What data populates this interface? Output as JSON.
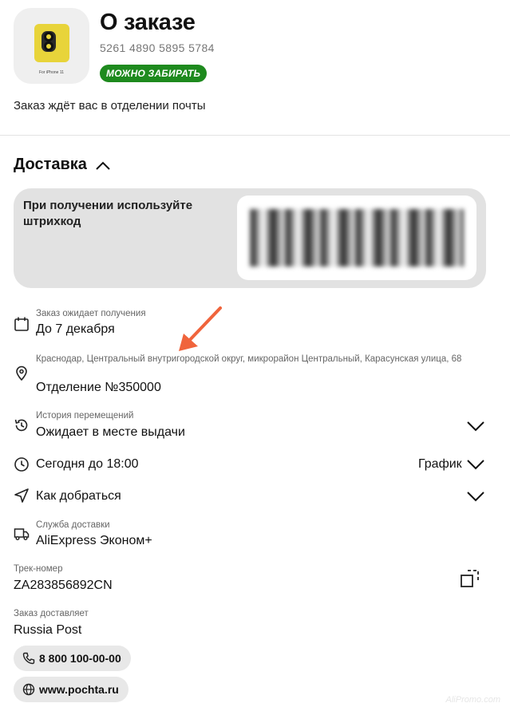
{
  "header": {
    "title": "О заказе",
    "order_number": "5261 4890 5895 5784",
    "status_badge": "МОЖНО ЗАБИРАТЬ",
    "thumb_caption": "For iPhone 11"
  },
  "wait_text": "Заказ ждёт вас в отделении почты",
  "delivery": {
    "section_title": "Доставка",
    "barcode_label": "При получении используйте штрихкод",
    "awaiting": {
      "label": "Заказ ожидает получения",
      "value": "До 7 декабря"
    },
    "address": {
      "label": "Краснодар, Центральный внутригородской округ, микрорайон Центральный, Карасунская улица, 68",
      "value": "Отделение №350000"
    },
    "history": {
      "label": "История перемещений",
      "value": "Ожидает в месте выдачи"
    },
    "hours": {
      "value": "Сегодня до 18:00",
      "schedule": "График"
    },
    "directions": {
      "value": "Как добраться"
    },
    "service": {
      "label": "Служба доставки",
      "value": "AliExpress Эконом+"
    },
    "track": {
      "label": "Трек-номер",
      "value": "ZA283856892CN"
    },
    "carrier": {
      "label": "Заказ доставляет",
      "value": "Russia Post"
    },
    "phone": "8 800 100-00-00",
    "website": "www.pochta.ru"
  },
  "watermark": "AliPromo.com",
  "colors": {
    "badge_green": "#1e8a1e",
    "arrow": "#f0643c",
    "card_gray": "#e2e2e2"
  }
}
